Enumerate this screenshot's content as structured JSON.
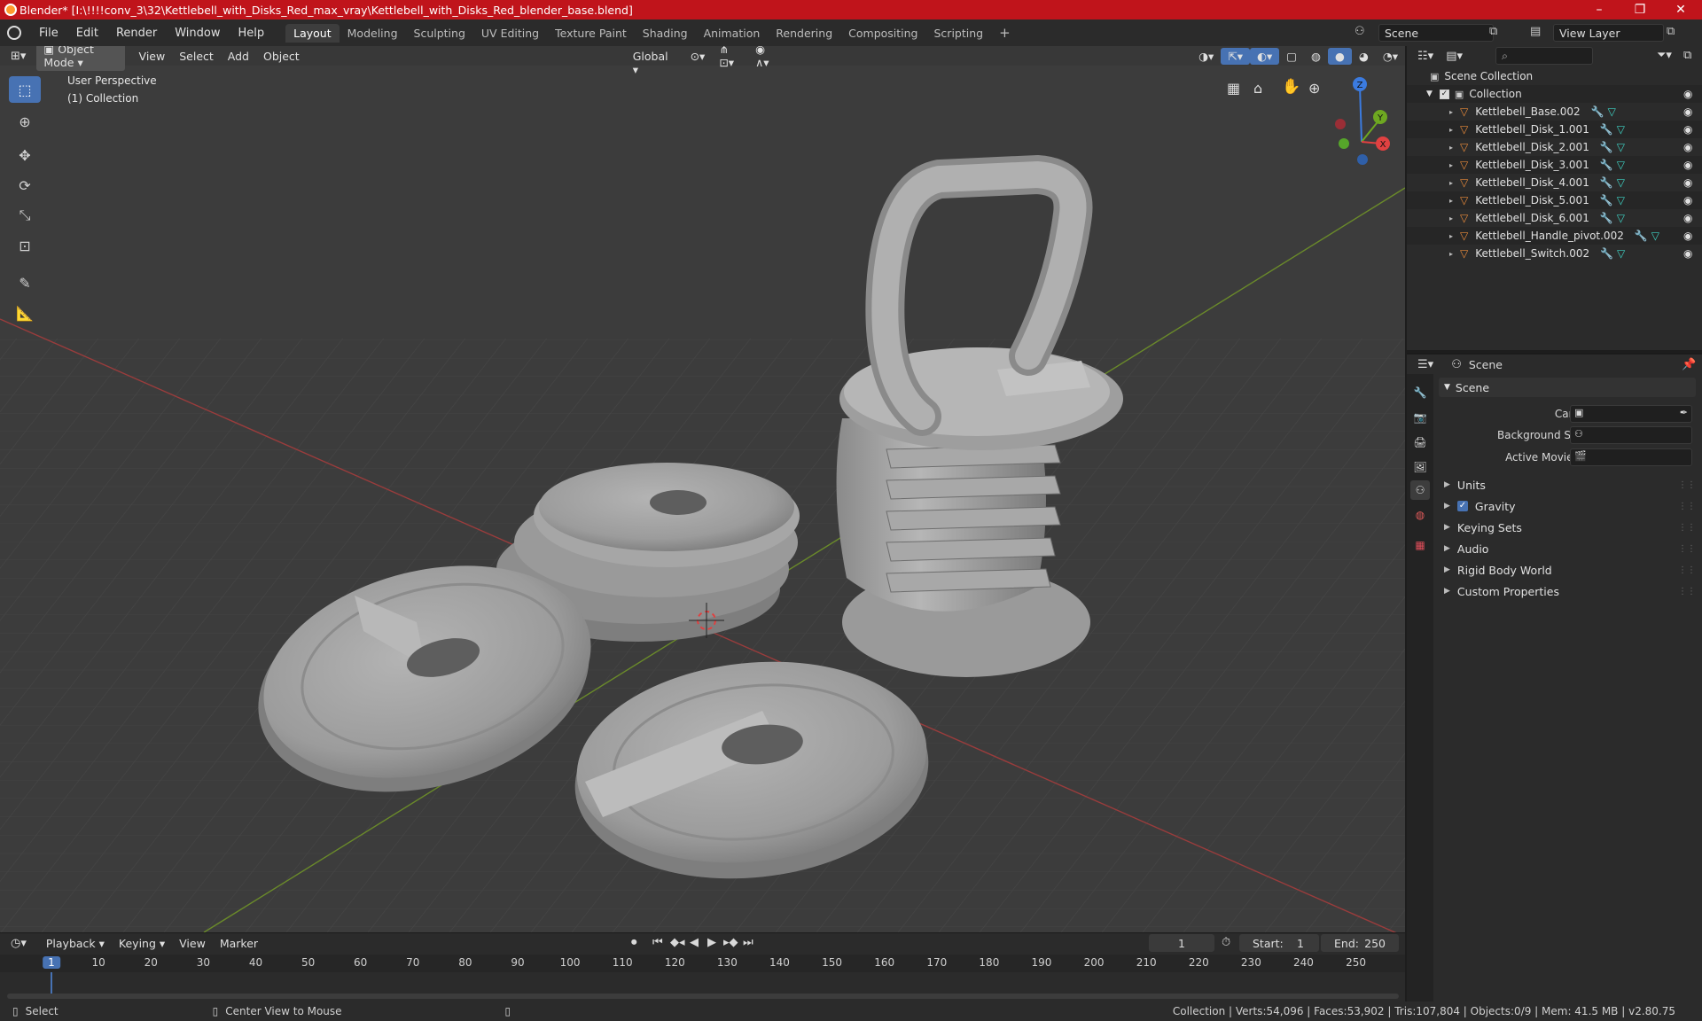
{
  "window": {
    "title": "Blender* [I:\\!!!!conv_3\\32\\Kettlebell_with_Disks_Red_max_vray\\Kettlebell_with_Disks_Red_blender_base.blend]",
    "minimize": "–",
    "maximize": "❐",
    "close": "✕"
  },
  "menu": [
    "File",
    "Edit",
    "Render",
    "Window",
    "Help"
  ],
  "workspaces": [
    "Layout",
    "Modeling",
    "Sculpting",
    "UV Editing",
    "Texture Paint",
    "Shading",
    "Animation",
    "Rendering",
    "Compositing",
    "Scripting"
  ],
  "add_workspace": "+",
  "scene_field": "Scene",
  "view_layer_field": "View Layer",
  "viewport": {
    "mode": "Object Mode",
    "menus": [
      "View",
      "Select",
      "Add",
      "Object"
    ],
    "transform_orientation": "Global",
    "overlay_line1": "User Perspective",
    "overlay_line2": "(1) Collection",
    "gizmo": {
      "x": "X",
      "y": "Y",
      "z": "Z"
    }
  },
  "outliner": {
    "search_placeholder": "",
    "scene_collection": "Scene Collection",
    "collection": "Collection",
    "objects": [
      "Kettlebell_Base.002",
      "Kettlebell_Disk_1.001",
      "Kettlebell_Disk_2.001",
      "Kettlebell_Disk_3.001",
      "Kettlebell_Disk_4.001",
      "Kettlebell_Disk_5.001",
      "Kettlebell_Disk_6.001",
      "Kettlebell_Handle_pivot.002",
      "Kettlebell_Switch.002"
    ]
  },
  "properties": {
    "context": "Scene",
    "panel_title": "Scene",
    "camera_label": "Camera",
    "background_scene_label": "Background Scene",
    "active_movie_clip_label": "Active Movie Clip",
    "subpanels": [
      "Units",
      "Gravity",
      "Keying Sets",
      "Audio",
      "Rigid Body World",
      "Custom Properties"
    ],
    "gravity_checked": true
  },
  "timeline": {
    "menus": [
      "Playback",
      "Keying",
      "View",
      "Marker"
    ],
    "current_frame": "1",
    "start_label": "Start:",
    "start": "1",
    "end_label": "End:",
    "end": "250",
    "ruler_ticks": [
      "1",
      "10",
      "20",
      "30",
      "40",
      "50",
      "60",
      "70",
      "80",
      "90",
      "100",
      "110",
      "120",
      "130",
      "140",
      "150",
      "160",
      "170",
      "180",
      "190",
      "200",
      "210",
      "220",
      "230",
      "240",
      "250"
    ]
  },
  "statusbar": {
    "select": "Select",
    "center_view": "Center View to Mouse",
    "stats": "Collection | Verts:54,096 | Faces:53,902 | Tris:107,804 | Objects:0/9 | Mem: 41.5 MB | v2.80.75"
  },
  "colors": {
    "titlebar": "#c0141b",
    "accent": "#4772b3",
    "object_icon": "#e98a3a",
    "modifier_icon": "#6ea2e8",
    "mesh_icon": "#3ed3c4"
  }
}
